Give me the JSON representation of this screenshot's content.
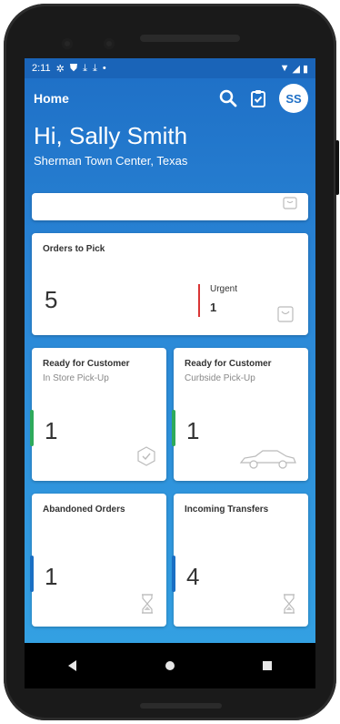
{
  "status": {
    "time": "2:11"
  },
  "header": {
    "title": "Home",
    "avatar_initials": "SS"
  },
  "greeting": "Hi, Sally Smith",
  "location": "Sherman Town Center, Texas",
  "orders_to_pick": {
    "title": "Orders to Pick",
    "count": "5",
    "urgent_label": "Urgent",
    "urgent_count": "1"
  },
  "tiles": [
    {
      "title": "Ready for Customer",
      "subtitle": "In Store Pick-Up",
      "count": "1",
      "accent": "#2eaa5b",
      "icon": "check-badge-icon"
    },
    {
      "title": "Ready for Customer",
      "subtitle": "Curbside Pick-Up",
      "count": "1",
      "accent": "#2eaa5b",
      "icon": "car-icon"
    },
    {
      "title": "Abandoned Orders",
      "subtitle": "",
      "count": "1",
      "accent": "#1a6fc4",
      "icon": "hourglass-icon"
    },
    {
      "title": "Incoming Transfers",
      "subtitle": "",
      "count": "4",
      "accent": "#1a6fc4",
      "icon": "hourglass-icon"
    }
  ],
  "colors": {
    "primary": "#1e6fc6",
    "urgent": "#d93535",
    "accent_green": "#2eaa5b",
    "accent_blue": "#1a6fc4"
  }
}
